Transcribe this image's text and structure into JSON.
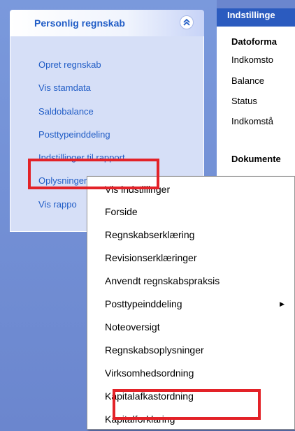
{
  "left_pane": {
    "group_title": "Personlig regnskab",
    "collapse_glyph": "«",
    "tasks": [
      "Opret regnskab",
      "Vis stamdata",
      "Saldobalance",
      "Posttypeinddeling",
      "Indstillinger til rapport",
      "Oplysninger til rapport",
      "Vis rappo"
    ]
  },
  "right_pane": {
    "header": "Indstillinge",
    "section1_title": "Datoforma",
    "section1_items": [
      "Indkomsto",
      "Balance",
      "Status",
      "Indkomstå"
    ],
    "section2_title": "Dokumente"
  },
  "context_menu": {
    "items": [
      {
        "label": "Vis indstillinger",
        "submenu": false
      },
      {
        "label": "Forside",
        "submenu": false
      },
      {
        "label": "Regnskabserklæring",
        "submenu": false
      },
      {
        "label": "Revisionserklæringer",
        "submenu": false
      },
      {
        "label": "Anvendt regnskabspraksis",
        "submenu": false
      },
      {
        "label": "Posttypeinddeling",
        "submenu": true
      },
      {
        "label": "Noteoversigt",
        "submenu": false
      },
      {
        "label": "Regnskabsoplysninger",
        "submenu": false
      },
      {
        "label": "Virksomhedsordning",
        "submenu": false
      },
      {
        "label": "Kapitalafkastordning",
        "submenu": false
      },
      {
        "label": "Kapitalforklaring",
        "submenu": false
      }
    ],
    "submenu_glyph": "▶"
  },
  "colors": {
    "accent": "#215dc6",
    "highlight": "#e32228",
    "header_blue": "#2b5bbf",
    "pane_bg": "#6b86ce"
  }
}
